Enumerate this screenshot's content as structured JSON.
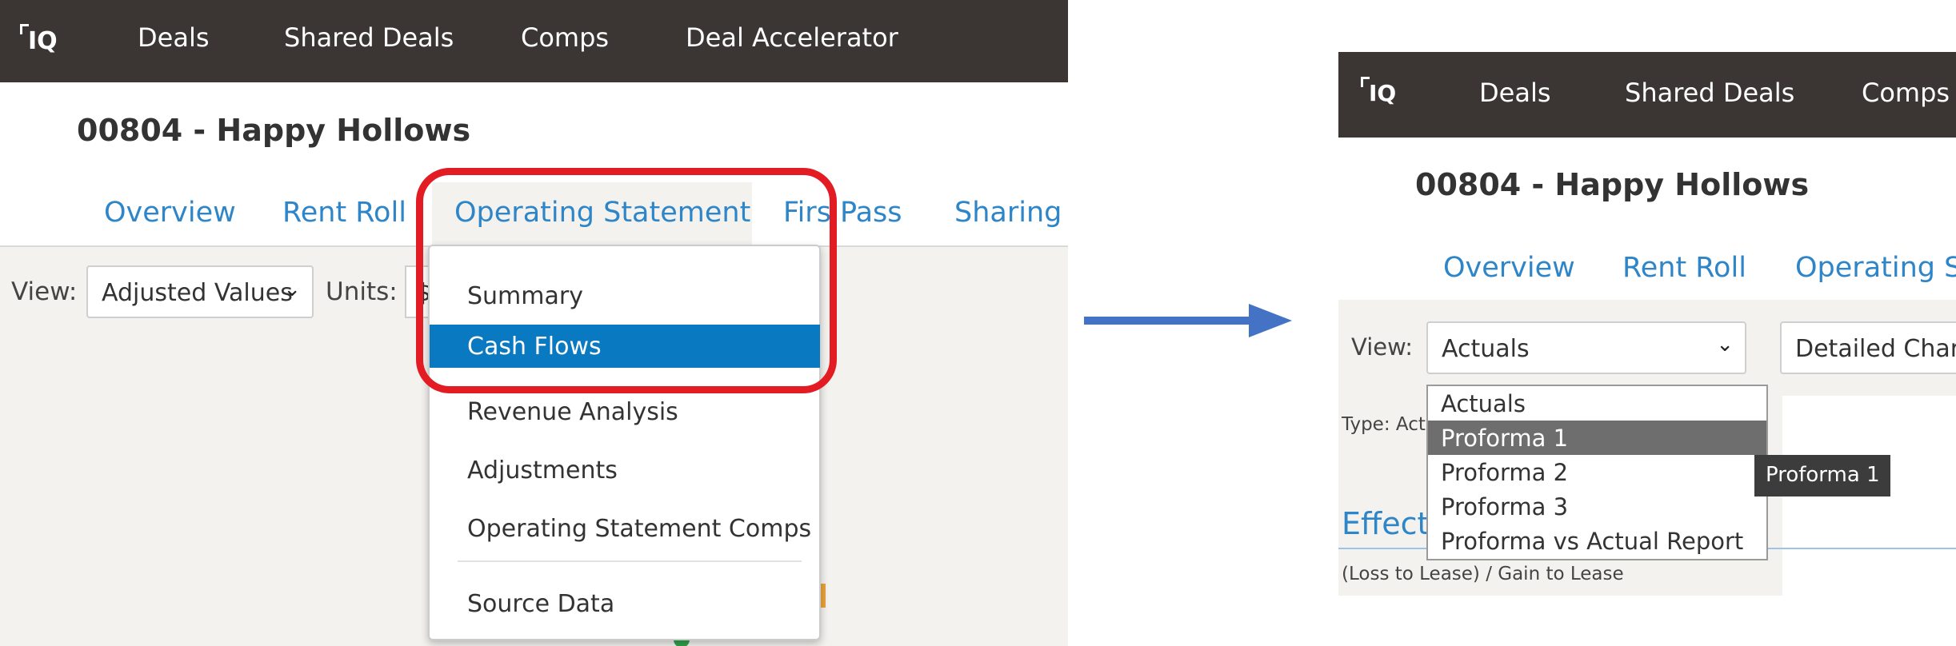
{
  "left": {
    "logo": "IQ",
    "nav": [
      "Deals",
      "Shared Deals",
      "Comps",
      "Deal Accelerator"
    ],
    "deal_title": "00804 - Happy Hollows",
    "tabs": [
      "Overview",
      "Rent Roll",
      "Operating Statement",
      "Firs Pass",
      "Sharing"
    ],
    "view_label": "View:",
    "view_value": "Adjusted Values",
    "units_label": "Units:",
    "units_value": "$",
    "menu": [
      "Summary",
      "Cash Flows",
      "Revenue Analysis",
      "Adjustments",
      "Operating Statement Comps",
      "Source Data"
    ],
    "menu_highlight": "Cash Flows",
    "annotation_color": "#e31b23"
  },
  "arrow_color": "#4472c4",
  "right": {
    "logo": "IQ",
    "nav": [
      "Deals",
      "Shared Deals",
      "Comps"
    ],
    "deal_title": "00804 - Happy Hollows",
    "tabs": [
      "Overview",
      "Rent Roll",
      "Operating St"
    ],
    "view_label": "View:",
    "view_value": "Actuals",
    "second_select_value": "Detailed Chart",
    "type_label": "Type: Act",
    "options": [
      "Actuals",
      "Proforma 1",
      "Proforma 2",
      "Proforma 3",
      "Proforma vs Actual Report"
    ],
    "option_highlight": "Proforma 1",
    "tooltip": "Proforma 1",
    "section_heading": "Effect",
    "row_label": "(Loss to Lease) / Gain to Lease"
  },
  "colors": {
    "nav_bg": "#3b3533",
    "link": "#2e85c7",
    "menu_highlight": "#0979c2",
    "option_highlight": "#6e6e6e"
  }
}
